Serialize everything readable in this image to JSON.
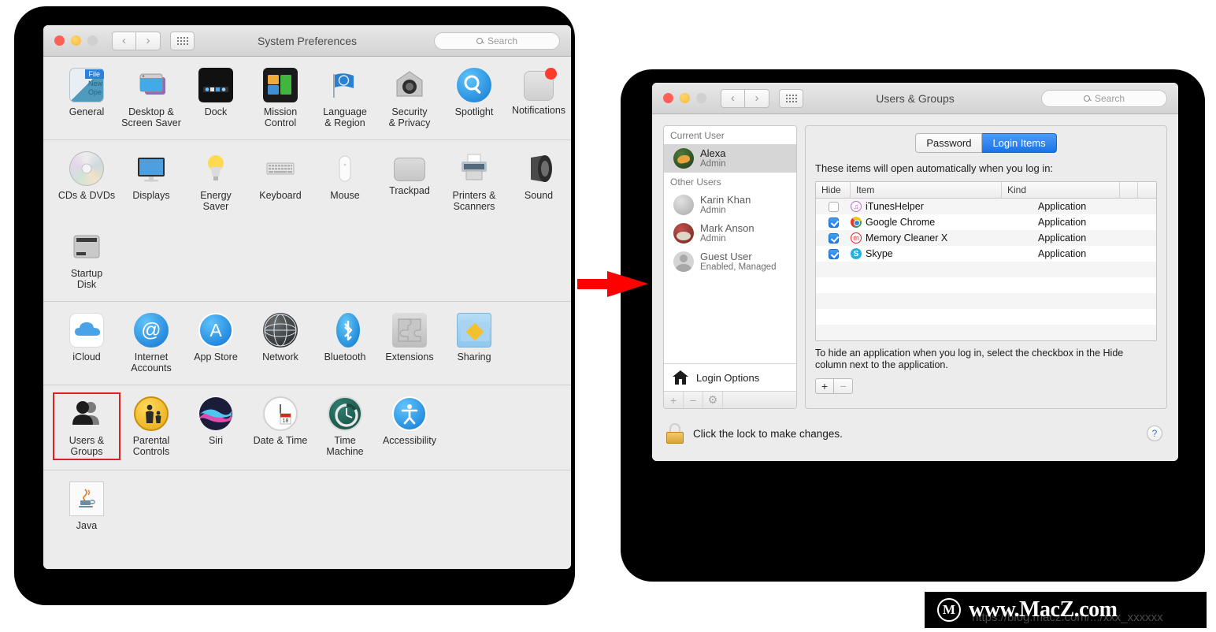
{
  "sysprefs": {
    "title": "System Preferences",
    "search_placeholder": "Search",
    "nav": {
      "back": "‹",
      "forward": "›"
    },
    "rows": [
      {
        "items": [
          {
            "label": "General",
            "icon": "general-icon"
          },
          {
            "label": "Desktop &\nScreen Saver",
            "icon": "desktop-screensaver-icon"
          },
          {
            "label": "Dock",
            "icon": "dock-icon"
          },
          {
            "label": "Mission\nControl",
            "icon": "mission-control-icon"
          },
          {
            "label": "Language\n& Region",
            "icon": "language-region-icon"
          },
          {
            "label": "Security\n& Privacy",
            "icon": "security-privacy-icon"
          },
          {
            "label": "Spotlight",
            "icon": "spotlight-icon"
          },
          {
            "label": "Notifications",
            "icon": "notifications-icon"
          }
        ]
      },
      {
        "items": [
          {
            "label": "CDs & DVDs",
            "icon": "cds-dvds-icon"
          },
          {
            "label": "Displays",
            "icon": "displays-icon"
          },
          {
            "label": "Energy\nSaver",
            "icon": "energy-saver-icon"
          },
          {
            "label": "Keyboard",
            "icon": "keyboard-icon"
          },
          {
            "label": "Mouse",
            "icon": "mouse-icon"
          },
          {
            "label": "Trackpad",
            "icon": "trackpad-icon"
          },
          {
            "label": "Printers &\nScanners",
            "icon": "printers-scanners-icon"
          },
          {
            "label": "Sound",
            "icon": "sound-icon"
          },
          {
            "label": "Startup\nDisk",
            "icon": "startup-disk-icon"
          }
        ]
      },
      {
        "items": [
          {
            "label": "iCloud",
            "icon": "icloud-icon"
          },
          {
            "label": "Internet\nAccounts",
            "icon": "internet-accounts-icon"
          },
          {
            "label": "App Store",
            "icon": "app-store-icon"
          },
          {
            "label": "Network",
            "icon": "network-icon"
          },
          {
            "label": "Bluetooth",
            "icon": "bluetooth-icon"
          },
          {
            "label": "Extensions",
            "icon": "extensions-icon"
          },
          {
            "label": "Sharing",
            "icon": "sharing-icon"
          }
        ]
      },
      {
        "items": [
          {
            "label": "Users &\nGroups",
            "icon": "users-groups-icon",
            "selected": true
          },
          {
            "label": "Parental\nControls",
            "icon": "parental-controls-icon"
          },
          {
            "label": "Siri",
            "icon": "siri-icon"
          },
          {
            "label": "Date & Time",
            "icon": "date-time-icon"
          },
          {
            "label": "Time\nMachine",
            "icon": "time-machine-icon"
          },
          {
            "label": "Accessibility",
            "icon": "accessibility-icon"
          }
        ]
      },
      {
        "items": [
          {
            "label": "Java",
            "icon": "java-icon"
          }
        ]
      }
    ]
  },
  "users_groups": {
    "title": "Users & Groups",
    "search_placeholder": "Search",
    "sidebar": {
      "current_user_header": "Current User",
      "other_users_header": "Other Users",
      "current_user": {
        "name": "Alexa",
        "role": "Admin",
        "avatar": "alexa-avatar"
      },
      "other_users": [
        {
          "name": "Karin Khan",
          "role": "Admin",
          "avatar": "karin-avatar"
        },
        {
          "name": "Mark Anson",
          "role": "Admin",
          "avatar": "mark-avatar"
        },
        {
          "name": "Guest User",
          "role": "Enabled, Managed",
          "avatar": "guest-avatar"
        }
      ],
      "login_options": "Login Options",
      "toolbar": {
        "add": "+",
        "remove": "−",
        "settings": "⚙"
      }
    },
    "tabs": [
      {
        "label": "Password",
        "active": false
      },
      {
        "label": "Login Items",
        "active": true
      }
    ],
    "hint": "These items will open automatically when you log in:",
    "table": {
      "columns": [
        "Hide",
        "Item",
        "Kind",
        "",
        ""
      ],
      "rows": [
        {
          "hide": false,
          "item": "iTunesHelper",
          "kind": "Application",
          "icon": "itunes-icon"
        },
        {
          "hide": true,
          "item": "Google Chrome",
          "kind": "Application",
          "icon": "chrome-icon"
        },
        {
          "hide": true,
          "item": "Memory Cleaner X",
          "kind": "Application",
          "icon": "memory-cleaner-icon"
        },
        {
          "hide": true,
          "item": "Skype",
          "kind": "Application",
          "icon": "skype-icon"
        }
      ],
      "empty_rows": 5
    },
    "footnote": "To hide an application when you log in, select the checkbox in the Hide column next to the application.",
    "plus_minus": {
      "add": "+",
      "remove": "−"
    },
    "lock_text": "Click the lock to make changes.",
    "help_label": "?"
  },
  "annotation": {
    "arrow_color": "#ff0000",
    "highlight_color": "#e02020"
  },
  "watermark": {
    "logo": "M",
    "text": "www.MacZ.com",
    "url": "https://blog.macz.com/.../xxx_xxxxxx"
  }
}
